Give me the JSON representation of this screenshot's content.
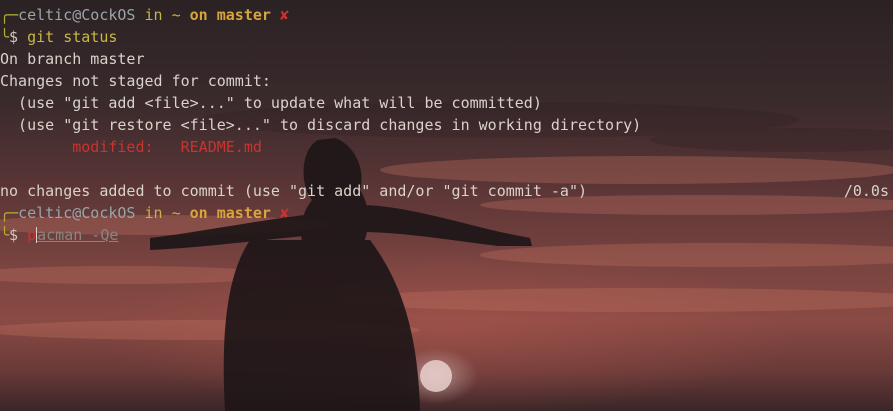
{
  "prompt1": {
    "corner": "╭─",
    "user": "celtic@CockOS",
    "in_kw": " in ",
    "dir": "~",
    "on_kw": " on ",
    "branch": "master",
    "dirty": " ✘"
  },
  "cmd1": {
    "corner": "╰",
    "dollar": "$ ",
    "text": "git status"
  },
  "output": {
    "l1": "On branch master",
    "l2": "Changes not staged for commit:",
    "l3": "  (use \"git add <file>...\" to update what will be committed)",
    "l4": "  (use \"git restore <file>...\" to discard changes in working directory)",
    "l5_label": "        modified:   ",
    "l5_file": "README.md",
    "l6": "",
    "l7": "no changes added to commit (use \"git add\" and/or \"git commit -a\")",
    "timing": "/0.0s"
  },
  "prompt2": {
    "corner": "╭─",
    "user": "celtic@CockOS",
    "in_kw": " in ",
    "dir": "~",
    "on_kw": " on ",
    "branch": "master",
    "dirty": " ✘"
  },
  "cmd2": {
    "corner": "╰",
    "dollar": "$ ",
    "typed": "p",
    "suggestion": "acman -Qe"
  }
}
